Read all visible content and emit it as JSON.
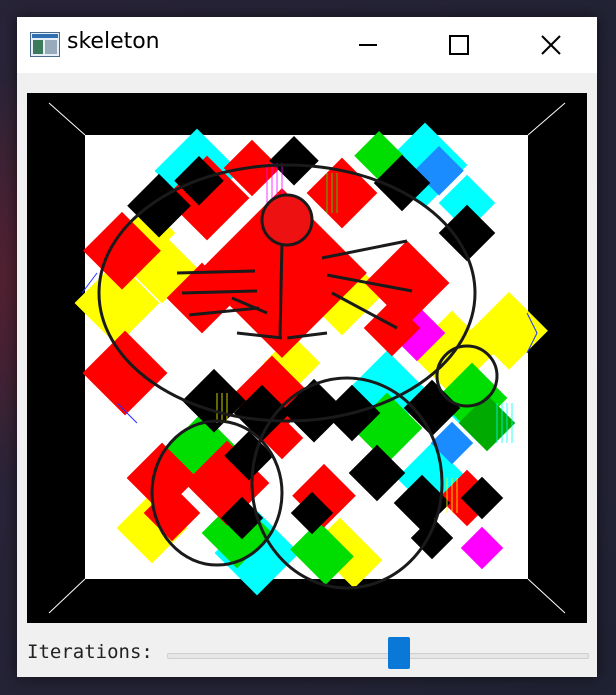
{
  "window": {
    "title": "skeleton",
    "controls": [
      "minimize-icon",
      "maximize-icon",
      "close-icon"
    ]
  },
  "app_icon": "image-window-icon",
  "canvas": {
    "description_colors": {
      "frame": "#000000",
      "background": "#ffffff",
      "skeleton": "#1a1a1a",
      "red": "#ff0000",
      "yellow": "#ffff00",
      "cyan": "#00ffff",
      "green": "#00dd00",
      "magenta": "#ff00ff",
      "blue": "#1a8cff"
    }
  },
  "controls": {
    "iterations_label": "Iterations:",
    "iterations_fraction": 0.55
  },
  "colors": {
    "accent": "#0a78d7"
  }
}
